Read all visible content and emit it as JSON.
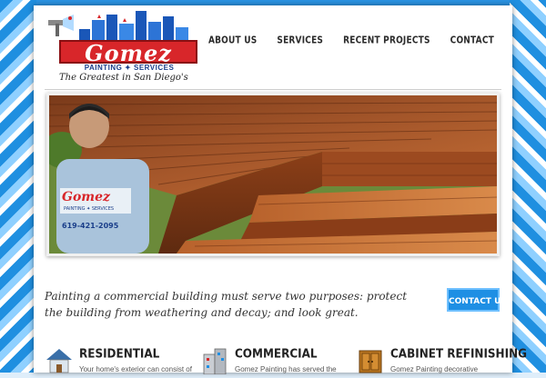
{
  "logo": {
    "brand": "Gomez",
    "sub": "PAINTING ✦ SERVICES",
    "tagline": "The Greatest in San Diego's"
  },
  "nav": [
    {
      "label": "ABOUT US"
    },
    {
      "label": "SERVICES"
    },
    {
      "label": "RECENT PROJECTS"
    },
    {
      "label": "CONTACT"
    }
  ],
  "hero": {
    "shirt_brand": "Gomez",
    "shirt_sub": "PAINTING ✦ SERVICES",
    "shirt_phone": "619-421-2095"
  },
  "intro": {
    "text": "Painting a commercial building must serve two purposes: protect the building from weathering and decay; and look great.",
    "button": "CONTACT US"
  },
  "services": [
    {
      "title": "RESIDENTIAL",
      "desc": "Your home's exterior can consist of",
      "icon": "house-icon"
    },
    {
      "title": "COMMERCIAL",
      "desc": "Gomez Painting has served the",
      "icon": "building-icon"
    },
    {
      "title": "CABINET REFINISHING",
      "desc": "Gomez Painting decorative",
      "icon": "cabinet-icon"
    }
  ],
  "colors": {
    "accent": "#1e8fe4",
    "brand_red": "#d8262a",
    "navy": "#1a3e8a"
  }
}
